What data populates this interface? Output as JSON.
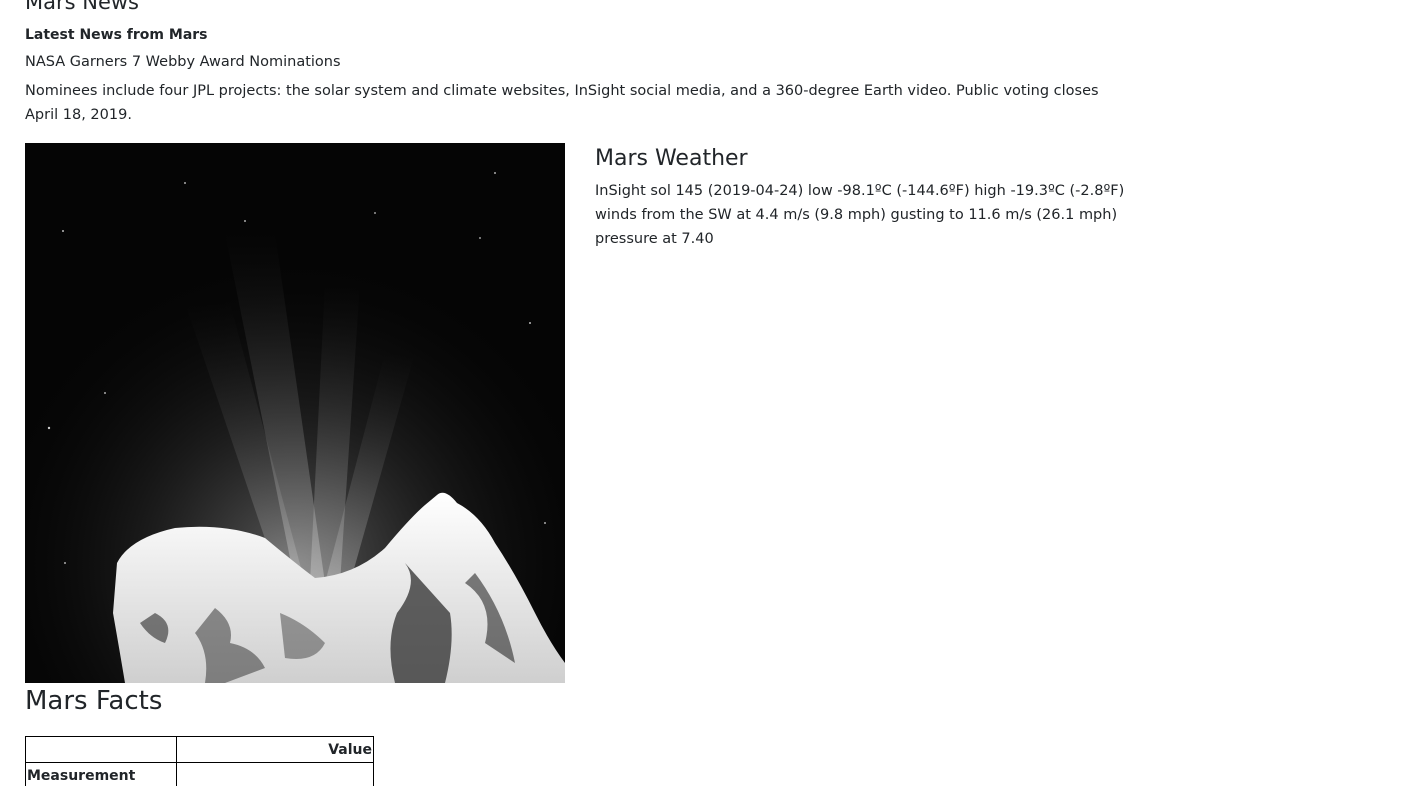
{
  "news": {
    "heading": "Mars News",
    "subheading": "Latest News from Mars",
    "title": "NASA Garners 7 Webby Award Nominations",
    "paragraph": "Nominees include four JPL projects: the solar system and climate websites, InSight social media, and a 360-degree Earth video. Public voting closes April 18, 2019."
  },
  "weather": {
    "heading": "Mars Weather",
    "report": "InSight sol 145 (2019-04-24) low -98.1ºC (-144.6ºF) high -19.3ºC (-2.8ºF) winds from the SW at 4.4 m/s (9.8 mph) gusting to 11.6 m/s (26.1 mph) pressure at 7.40"
  },
  "facts": {
    "heading": "Mars Facts",
    "columns": [
      "",
      "Value"
    ],
    "row_header_label": "Measurement"
  },
  "colors": {
    "text": "#212529",
    "table_border": "#000000",
    "background": "#ffffff"
  }
}
